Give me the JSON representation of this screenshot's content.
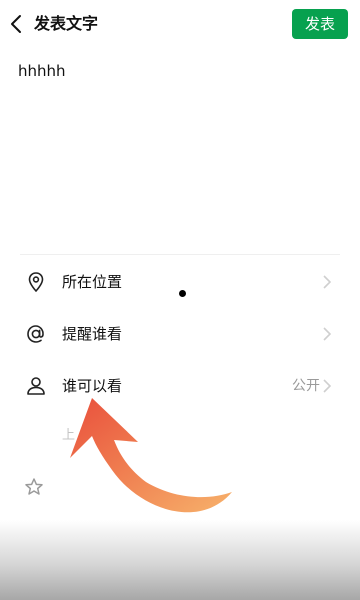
{
  "header": {
    "back_icon": "chevron-left-icon",
    "title": "发表文字",
    "publish_label": "发表",
    "publish_color": "#07a14f"
  },
  "post": {
    "text": "hhhhh"
  },
  "options": [
    {
      "icon": "location-pin-icon",
      "label": "所在位置",
      "value": ""
    },
    {
      "icon": "at-sign-icon",
      "label": "提醒谁看",
      "value": ""
    },
    {
      "icon": "person-icon",
      "label": "谁可以看",
      "value": "公开"
    }
  ],
  "faded_row": {
    "text": "上"
  },
  "overlay": {
    "arrow_color_start": "#f7b26b",
    "arrow_color_end": "#e94f3c"
  }
}
